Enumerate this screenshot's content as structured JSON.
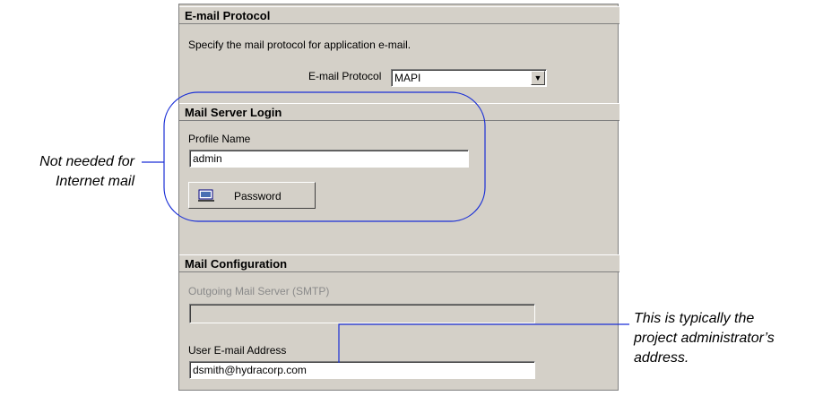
{
  "email_protocol": {
    "header": "E-mail Protocol",
    "description": "Specify the mail protocol for application e-mail.",
    "protocol_label": "E-mail Protocol",
    "protocol_value": "MAPI"
  },
  "mail_server_login": {
    "header": "Mail Server Login",
    "profile_label": "Profile Name",
    "profile_value": "admin",
    "password_button": "Password"
  },
  "mail_configuration": {
    "header": "Mail Configuration",
    "smtp_label": "Outgoing Mail Server (SMTP)",
    "smtp_value": "",
    "email_label": "User E-mail Address",
    "email_value": "dsmith@hydracorp.com"
  },
  "annotations": {
    "left_line1": "Not needed for",
    "left_line2": "Internet mail",
    "right_line1": "This is typically the",
    "right_line2": "project administrator’s",
    "right_line3": "address."
  },
  "colors": {
    "panel_bg": "#d4d0c8",
    "callout_line": "#1a2fd6"
  }
}
